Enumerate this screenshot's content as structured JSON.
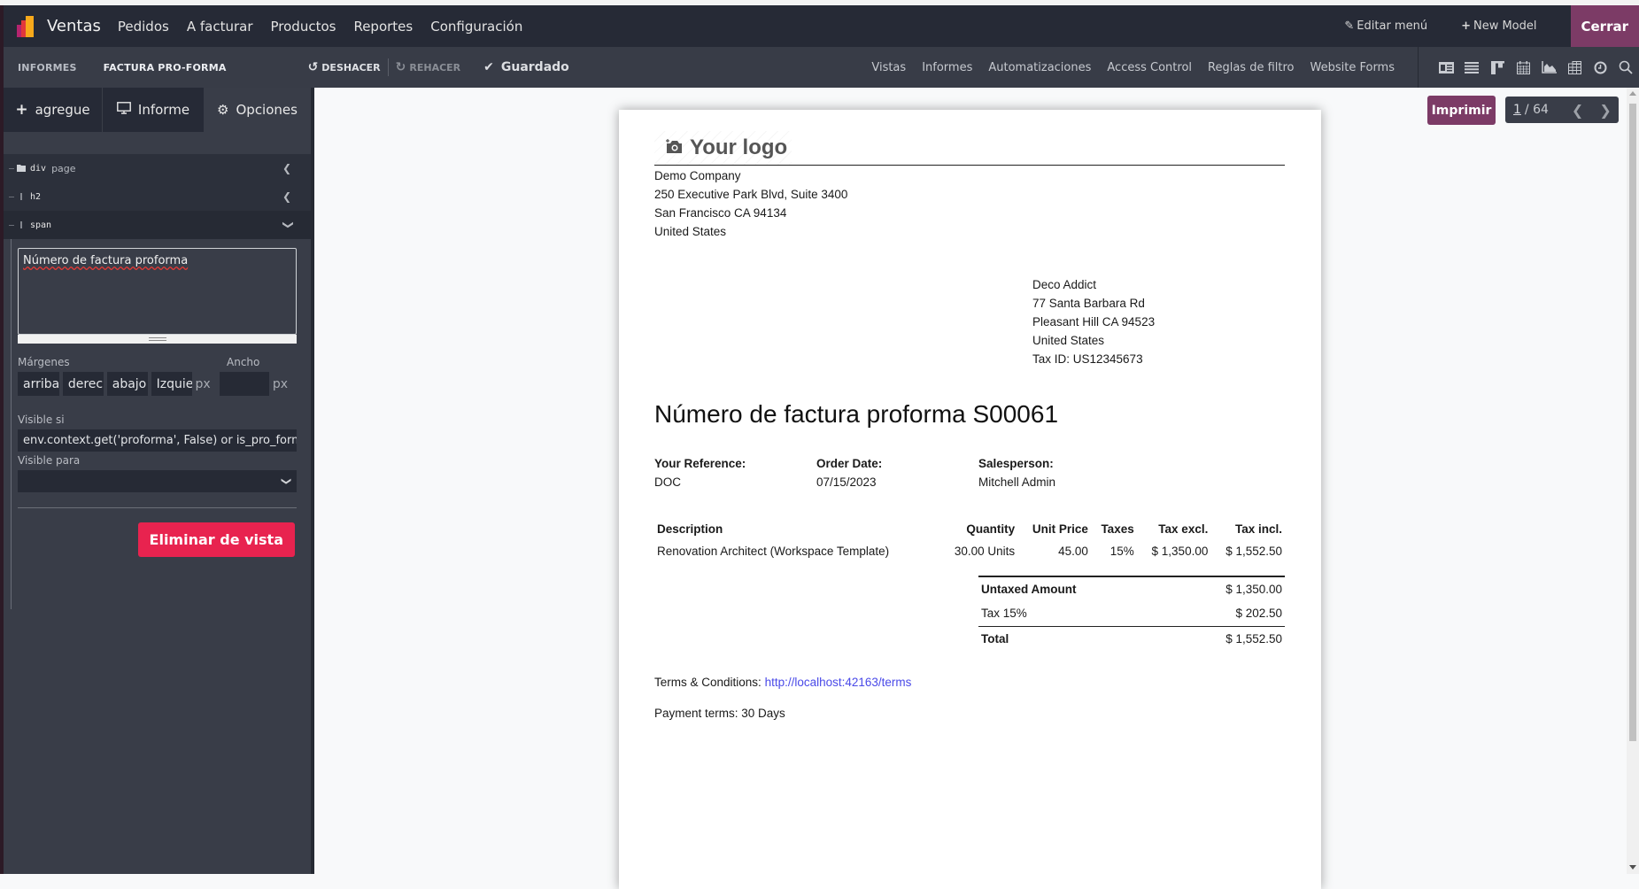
{
  "navbar": {
    "app_name": "Ventas",
    "menu": [
      "Pedidos",
      "A facturar",
      "Productos",
      "Reportes",
      "Configuración"
    ],
    "edit_menu": "Editar menú",
    "new_model": "New Model",
    "close": "Cerrar"
  },
  "toolbar": {
    "breadcrumbs": [
      "INFORMES",
      "FACTURA PRO-FORMA"
    ],
    "undo": "DESHACER",
    "redo": "REHACER",
    "saved": "Guardado",
    "links": [
      "Vistas",
      "Informes",
      "Automatizaciones",
      "Access Control",
      "Reglas de filtro",
      "Website Forms"
    ],
    "view_icons": [
      "form-view-icon",
      "list-view-icon",
      "kanban-view-icon",
      "calendar-view-icon",
      "graph-view-icon",
      "pivot-view-icon",
      "activity-view-icon",
      "search-view-icon"
    ]
  },
  "sidebar": {
    "tabs": [
      {
        "label": "agregue",
        "icon": "plus-icon"
      },
      {
        "label": "Informe",
        "icon": "monitor-icon"
      },
      {
        "label": "Opciones",
        "icon": "gear-icon",
        "active": true
      }
    ],
    "tree": [
      {
        "tag": "div",
        "class": "page",
        "icon": "folder-icon"
      },
      {
        "tag": "h2",
        "class": "",
        "icon": "text-cursor-icon"
      },
      {
        "tag": "span",
        "class": "",
        "icon": "text-cursor-icon",
        "selected": true
      }
    ],
    "text_value": "Número de factura proforma",
    "margins_label": "Márgenes",
    "margins": [
      "arriba",
      "derec",
      "abajo",
      "Izquie"
    ],
    "px_unit": "px",
    "width_label": "Ancho",
    "width_value": "",
    "visible_if_label": "Visible si",
    "visible_if_value": "env.context.get('proforma', False) or is_pro_forma",
    "visible_for_label": "Visible para",
    "visible_for_value": "",
    "delete_button": "Eliminar de vista"
  },
  "preview": {
    "print_button": "Imprimir",
    "pager_current": "1",
    "pager_total": "/ 64"
  },
  "document": {
    "logo_text": "Your logo",
    "company": [
      "Demo Company",
      "250 Executive Park Blvd, Suite 3400",
      "San Francisco CA 94134",
      "United States"
    ],
    "partner": [
      "Deco Addict",
      "77 Santa Barbara Rd",
      "Pleasant Hill CA 94523",
      "United States",
      "Tax ID: US12345673"
    ],
    "title": "Número de factura proforma S00061",
    "info": [
      {
        "label": "Your Reference:",
        "value": "DOC"
      },
      {
        "label": "Order Date:",
        "value": "07/15/2023"
      },
      {
        "label": "Salesperson:",
        "value": "Mitchell Admin"
      }
    ],
    "columns": [
      "Description",
      "Quantity",
      "Unit Price",
      "Taxes",
      "Tax excl.",
      "Tax incl."
    ],
    "lines": [
      [
        "Renovation Architect (Workspace Template)",
        "30.00 Units",
        "45.00",
        "15%",
        "$ 1,350.00",
        "$ 1,552.50"
      ]
    ],
    "totals": [
      {
        "label": "Untaxed Amount",
        "value": "$ 1,350.00"
      },
      {
        "label": "Tax 15%",
        "value": "$ 202.50"
      },
      {
        "label": "Total",
        "value": "$ 1,552.50"
      }
    ],
    "terms_label": "Terms & Conditions:",
    "terms_link": "http://localhost:42163/terms",
    "payment_terms": "Payment terms: 30 Days"
  }
}
